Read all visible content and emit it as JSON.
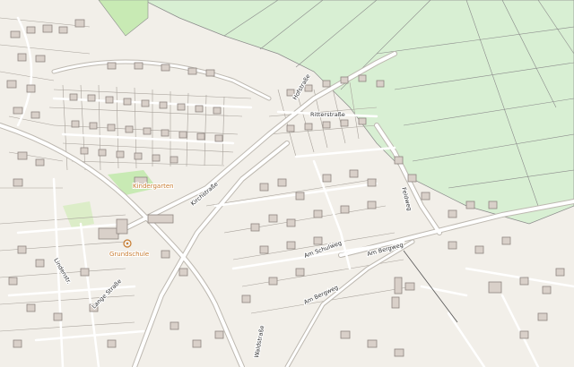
{
  "map": {
    "colors": {
      "background": "#f2efe9",
      "farmland": "#d8efd3",
      "grass": "#c8eab4",
      "building": "#d9d0c9",
      "road": "#ffffff",
      "poi": "#c77b30"
    },
    "labels": {
      "street_top": "Ritterstraße",
      "street_mid": "Hofstraße",
      "street_diag": "Kirchstraße",
      "street_east": "Am Bergweg",
      "street_center": "Am Schulweg",
      "street_south": "Am Bergweg",
      "street_west": "Lindenstr.",
      "street_sw": "Lange Straße",
      "street_bottom": "Waldstraße",
      "street_vert": "Feldweg",
      "poi_school": "Grundschule",
      "poi_church": "Kindergarten"
    }
  }
}
